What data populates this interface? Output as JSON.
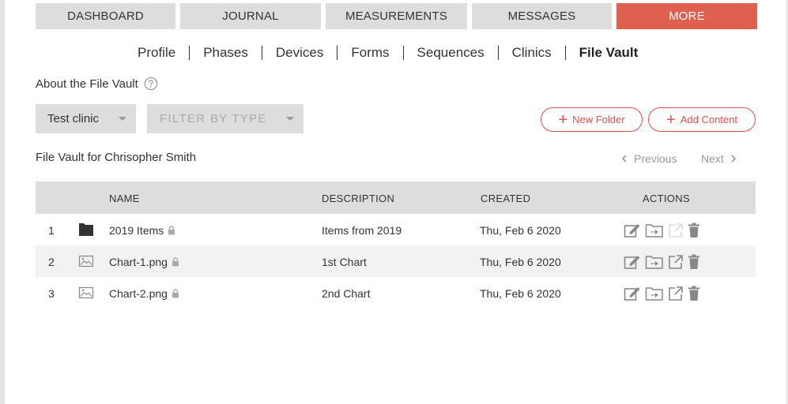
{
  "nav": {
    "tabs": [
      {
        "label": "DASHBOARD"
      },
      {
        "label": "JOURNAL"
      },
      {
        "label": "MEASUREMENTS"
      },
      {
        "label": "MESSAGES"
      },
      {
        "label": "MORE"
      }
    ]
  },
  "subnav": {
    "items": [
      {
        "label": "Profile"
      },
      {
        "label": "Phases"
      },
      {
        "label": "Devices"
      },
      {
        "label": "Forms"
      },
      {
        "label": "Sequences"
      },
      {
        "label": "Clinics"
      },
      {
        "label": "File Vault"
      }
    ],
    "active": "File Vault"
  },
  "about": {
    "label": "About the File Vault",
    "icon": "help-circle-icon"
  },
  "filters": {
    "clinic": {
      "value": "Test clinic"
    },
    "type": {
      "placeholder": "FILTER BY TYPE"
    }
  },
  "buttons": {
    "new_folder": "New Folder",
    "add_content": "Add Content"
  },
  "vault": {
    "title": "File Vault for Chrisopher Smith"
  },
  "pager": {
    "previous": "Previous",
    "next": "Next"
  },
  "table": {
    "headers": {
      "name": "NAME",
      "description": "DESCRIPTION",
      "created": "CREATED",
      "actions": "ACTIONS"
    },
    "rows": [
      {
        "num": "1",
        "type": "folder-icon",
        "name": "2019 Items",
        "description": "Items from 2019",
        "created": "Thu, Feb 6 2020"
      },
      {
        "num": "2",
        "type": "image-icon",
        "name": "Chart-1.png",
        "description": "1st Chart",
        "created": "Thu, Feb 6 2020"
      },
      {
        "num": "3",
        "type": "image-icon",
        "name": "Chart-2.png",
        "description": "2nd Chart",
        "created": "Thu, Feb 6 2020"
      }
    ]
  },
  "colors": {
    "accent": "#e06050",
    "tab_bg": "#dddddd",
    "row_alt": "#f2f2f2"
  }
}
